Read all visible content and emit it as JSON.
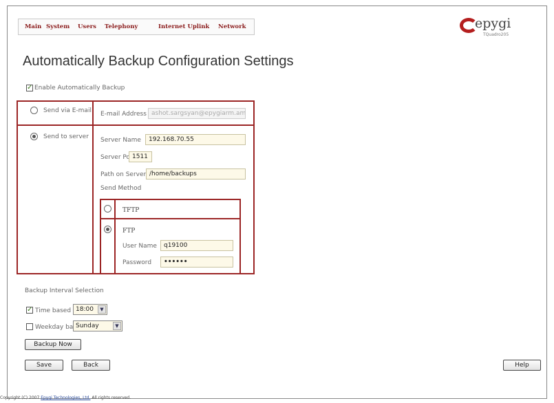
{
  "nav": {
    "items": [
      "Main",
      "System",
      "Users",
      "Telephony",
      "Internet Uplink",
      "Network"
    ]
  },
  "logo": {
    "name": "epygi",
    "model": "TQuadro205"
  },
  "page_title": "Automatically Backup Configuration Settings",
  "enable_backup": {
    "label": "Enable Automatically Backup",
    "checked": true
  },
  "email_option": {
    "label": "Send via E-mail",
    "address_label": "E-mail Address",
    "address_value": "ashot.sargsyan@epygiarm.am",
    "selected": false
  },
  "server_option": {
    "label": "Send to server",
    "selected": true,
    "server_name_label": "Server Name",
    "server_name_value": "192.168.70.55",
    "server_port_label": "Server Port",
    "server_port_value": "1511",
    "path_label": "Path on Server",
    "path_value": "/home/backups",
    "send_method_label": "Send Method",
    "tftp_label": "TFTP",
    "ftp_label": "FTP",
    "ftp_selected": true,
    "user_name_label": "User Name",
    "user_name_value": "q19100",
    "password_label": "Password",
    "password_value": "••••••"
  },
  "interval": {
    "section_label": "Backup Interval Selection",
    "time_based_label": "Time based",
    "time_based_checked": true,
    "time_value": "18:00",
    "weekday_based_label": "Weekday based",
    "weekday_based_checked": false,
    "weekday_value": "Sunday"
  },
  "buttons": {
    "backup_now": "Backup Now",
    "save": "Save",
    "back": "Back",
    "help": "Help"
  },
  "footer": {
    "prefix": "Copyright (C) 2007 ",
    "link": "Epygi Technologies, Ltd.",
    "suffix": " All rights reserved."
  },
  "colors": {
    "accent": "#9b2424",
    "nav_text": "#8b1c1c",
    "input_bg": "#fdf9e8"
  }
}
